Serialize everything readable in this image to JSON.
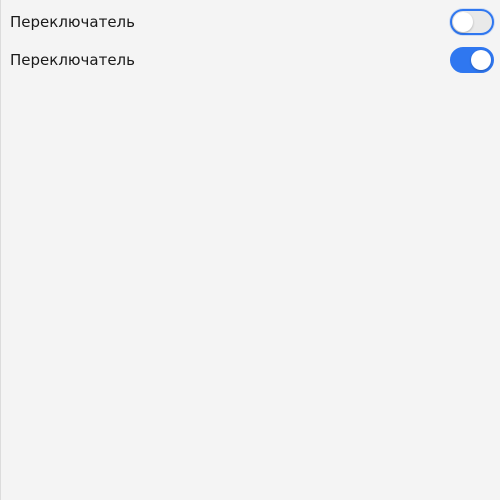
{
  "switches": [
    {
      "label": "Переключатель",
      "checked": false,
      "focused": true
    },
    {
      "label": "Переключатель",
      "checked": true,
      "focused": false
    }
  ],
  "colors": {
    "accent": "#2f77f0",
    "background": "#f4f4f4",
    "track_off": "#e9e9e9",
    "knob": "#ffffff",
    "text": "#1a1a1a"
  }
}
